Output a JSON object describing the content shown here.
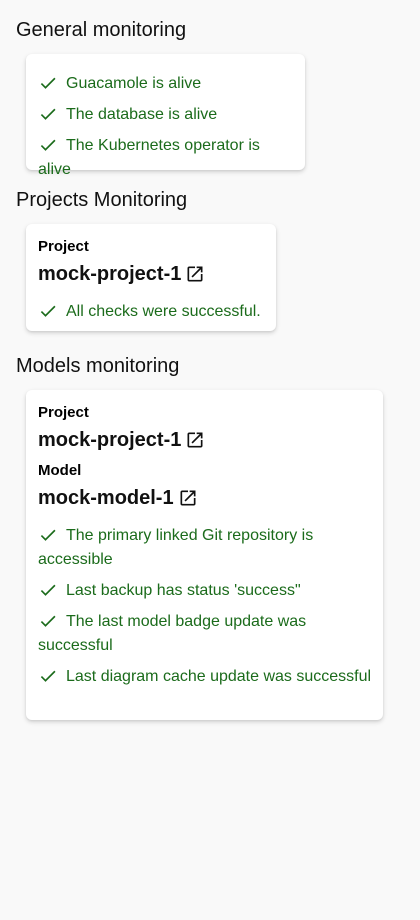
{
  "colors": {
    "success_green": "#1b6b1b",
    "background": "#f9f9f9",
    "card": "#ffffff"
  },
  "icons": {
    "check": "check-icon",
    "external_link": "open-in-new-icon"
  },
  "general": {
    "title": "General monitoring",
    "checks": [
      "Guacamole is alive",
      "The database is alive",
      "The Kubernetes operator is alive"
    ]
  },
  "projects": {
    "title": "Projects Monitoring",
    "project_label": "Project",
    "project_name": "mock-project-1",
    "status": "All checks were successful."
  },
  "models": {
    "title": "Models monitoring",
    "project_label": "Project",
    "project_name": "mock-project-1",
    "model_label": "Model",
    "model_name": "mock-model-1",
    "checks": [
      "The primary linked Git repository is accessible",
      "Last backup has status 'success\"",
      "The last model badge update was successful",
      "Last diagram cache update was successful"
    ]
  }
}
